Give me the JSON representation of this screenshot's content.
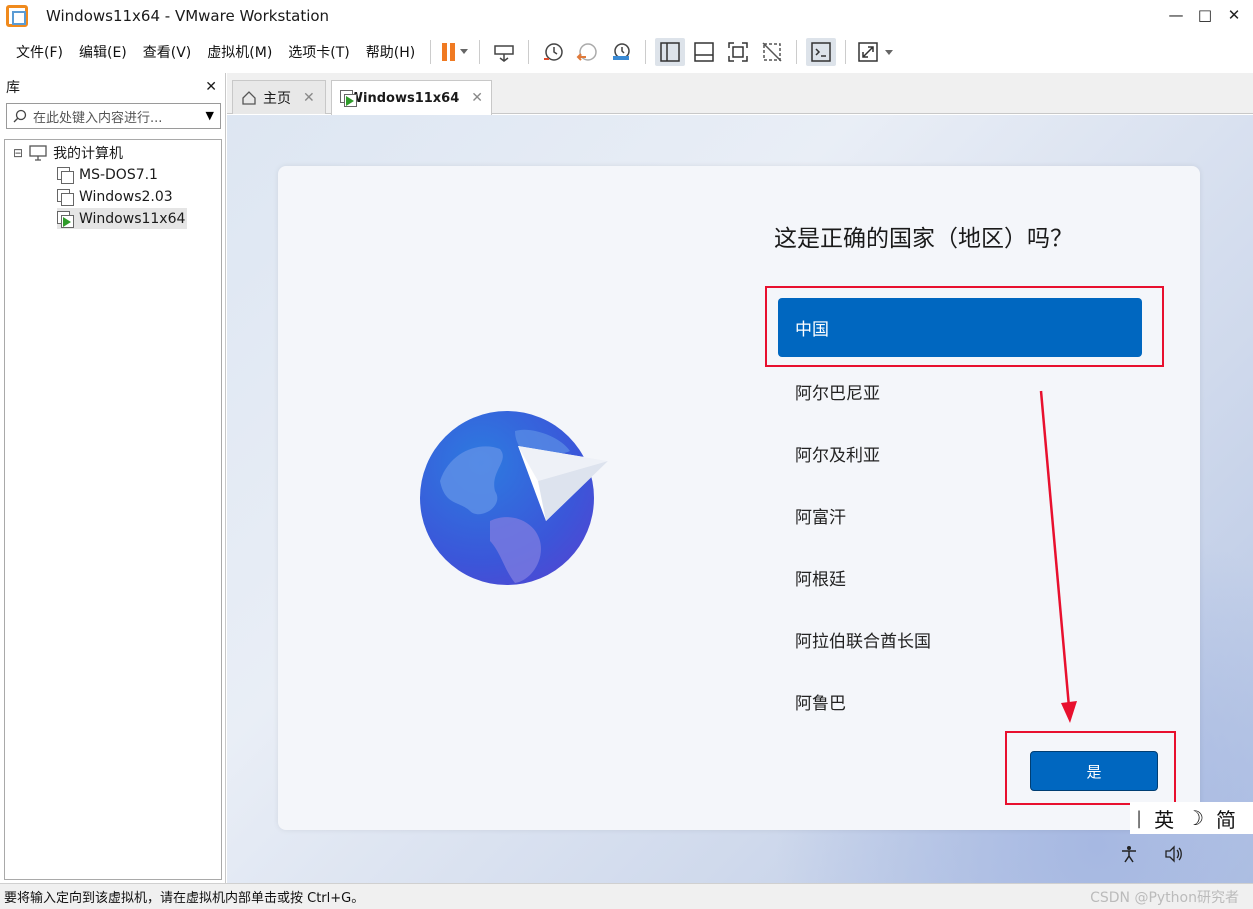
{
  "window": {
    "title": "Windows11x64 - VMware Workstation",
    "minimize": "—",
    "maximize": "□",
    "close": "✕"
  },
  "menu": [
    "文件(F)",
    "编辑(E)",
    "查看(V)",
    "虚拟机(M)",
    "选项卡(T)",
    "帮助(H)"
  ],
  "library": {
    "title": "库",
    "close": "✕",
    "search_placeholder": "在此处键入内容进行...",
    "tree": {
      "root": "我的计算机",
      "expander": "⊟",
      "items": [
        "MS-DOS7.1",
        "Windows2.03",
        "Windows11x64"
      ],
      "selected": "Windows11x64"
    }
  },
  "tabs": [
    {
      "label": "主页",
      "close": "✕"
    },
    {
      "label": "Windows11x64",
      "close": "✕"
    }
  ],
  "oobe": {
    "title": "这是正确的国家（地区）吗？",
    "countries": [
      "中国",
      "阿尔巴尼亚",
      "阿尔及利亚",
      "阿富汗",
      "阿根廷",
      "阿拉伯联合酋长国",
      "阿鲁巴"
    ],
    "selected": "中国",
    "yes_button": "是",
    "ime": {
      "mode": "英",
      "moon": "☽",
      "charset": "简"
    },
    "accessibility_icon": "accessibility-icon",
    "volume_icon": "volume-icon"
  },
  "statusbar": {
    "text": "要将输入定向到该虚拟机，请在虚拟机内部单击或按 Ctrl+G。",
    "watermark": "CSDN @Python研究者"
  },
  "colors": {
    "accent": "#0067c0",
    "annotation_red": "#e8102e",
    "pause_orange": "#f07a22"
  }
}
